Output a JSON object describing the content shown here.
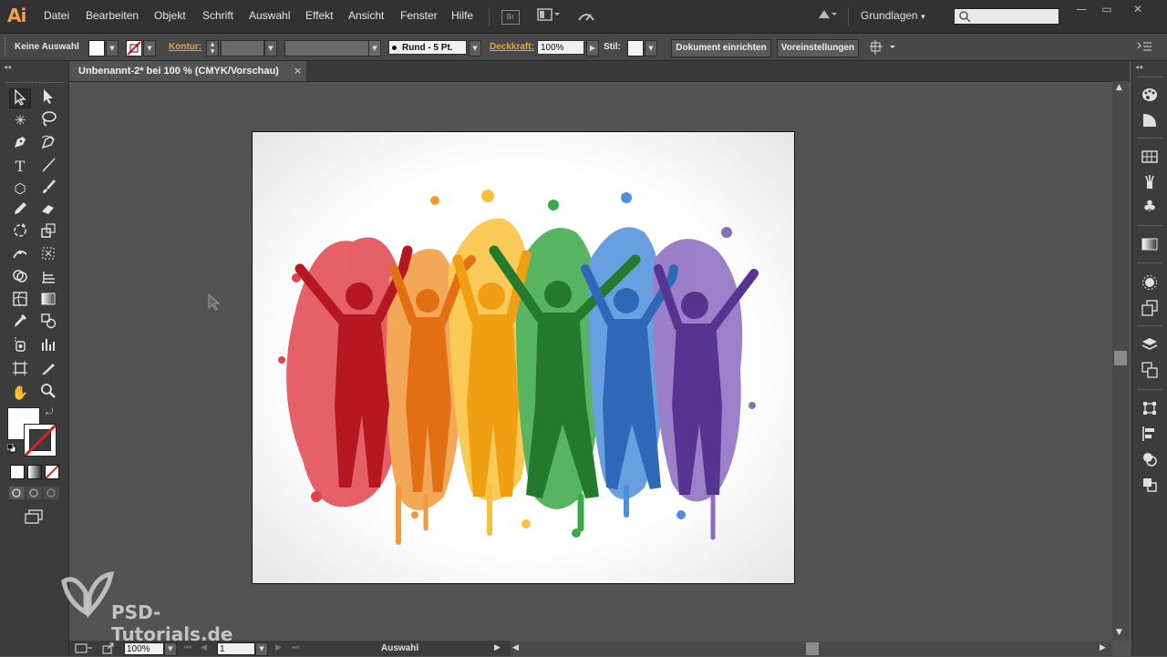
{
  "app": {
    "logo": "Ai"
  },
  "menu": [
    "Datei",
    "Bearbeiten",
    "Objekt",
    "Schrift",
    "Auswahl",
    "Effekt",
    "Ansicht",
    "Fenster",
    "Hilfe"
  ],
  "menubar": {
    "bridge_label": "Br",
    "workspace": "Grundlagen",
    "workspace_arrow": "▾",
    "search_value": ""
  },
  "window_buttons": {
    "minimize": "—",
    "restore": "▭",
    "close": "✕"
  },
  "controlbar": {
    "selection_label": "Keine Auswahl",
    "stroke_label": "Kontur:",
    "brush_label": "Rund - 5 Pt.",
    "opacity_label": "Deckkraft:",
    "opacity_value": "100%",
    "style_label": "Stil:",
    "doc_setup_button": "Dokument einrichten",
    "preferences_button": "Voreinstellungen"
  },
  "document_tab": {
    "title": "Unbenannt-2* bei 100 % (CMYK/Vorschau)",
    "close": "×"
  },
  "statusbar": {
    "zoom": "100%",
    "artboard": "1",
    "tool_status": "Auswahl"
  },
  "watermark": {
    "text": "PSD-Tutorials.de"
  },
  "colors": {
    "accent_orange": "#e8a23a",
    "red": "#c8232b",
    "orange": "#f08a1c",
    "yellow": "#f6b21e",
    "green": "#2e9a3a",
    "blue": "#3d7fcf",
    "purple": "#6a4aa0"
  }
}
